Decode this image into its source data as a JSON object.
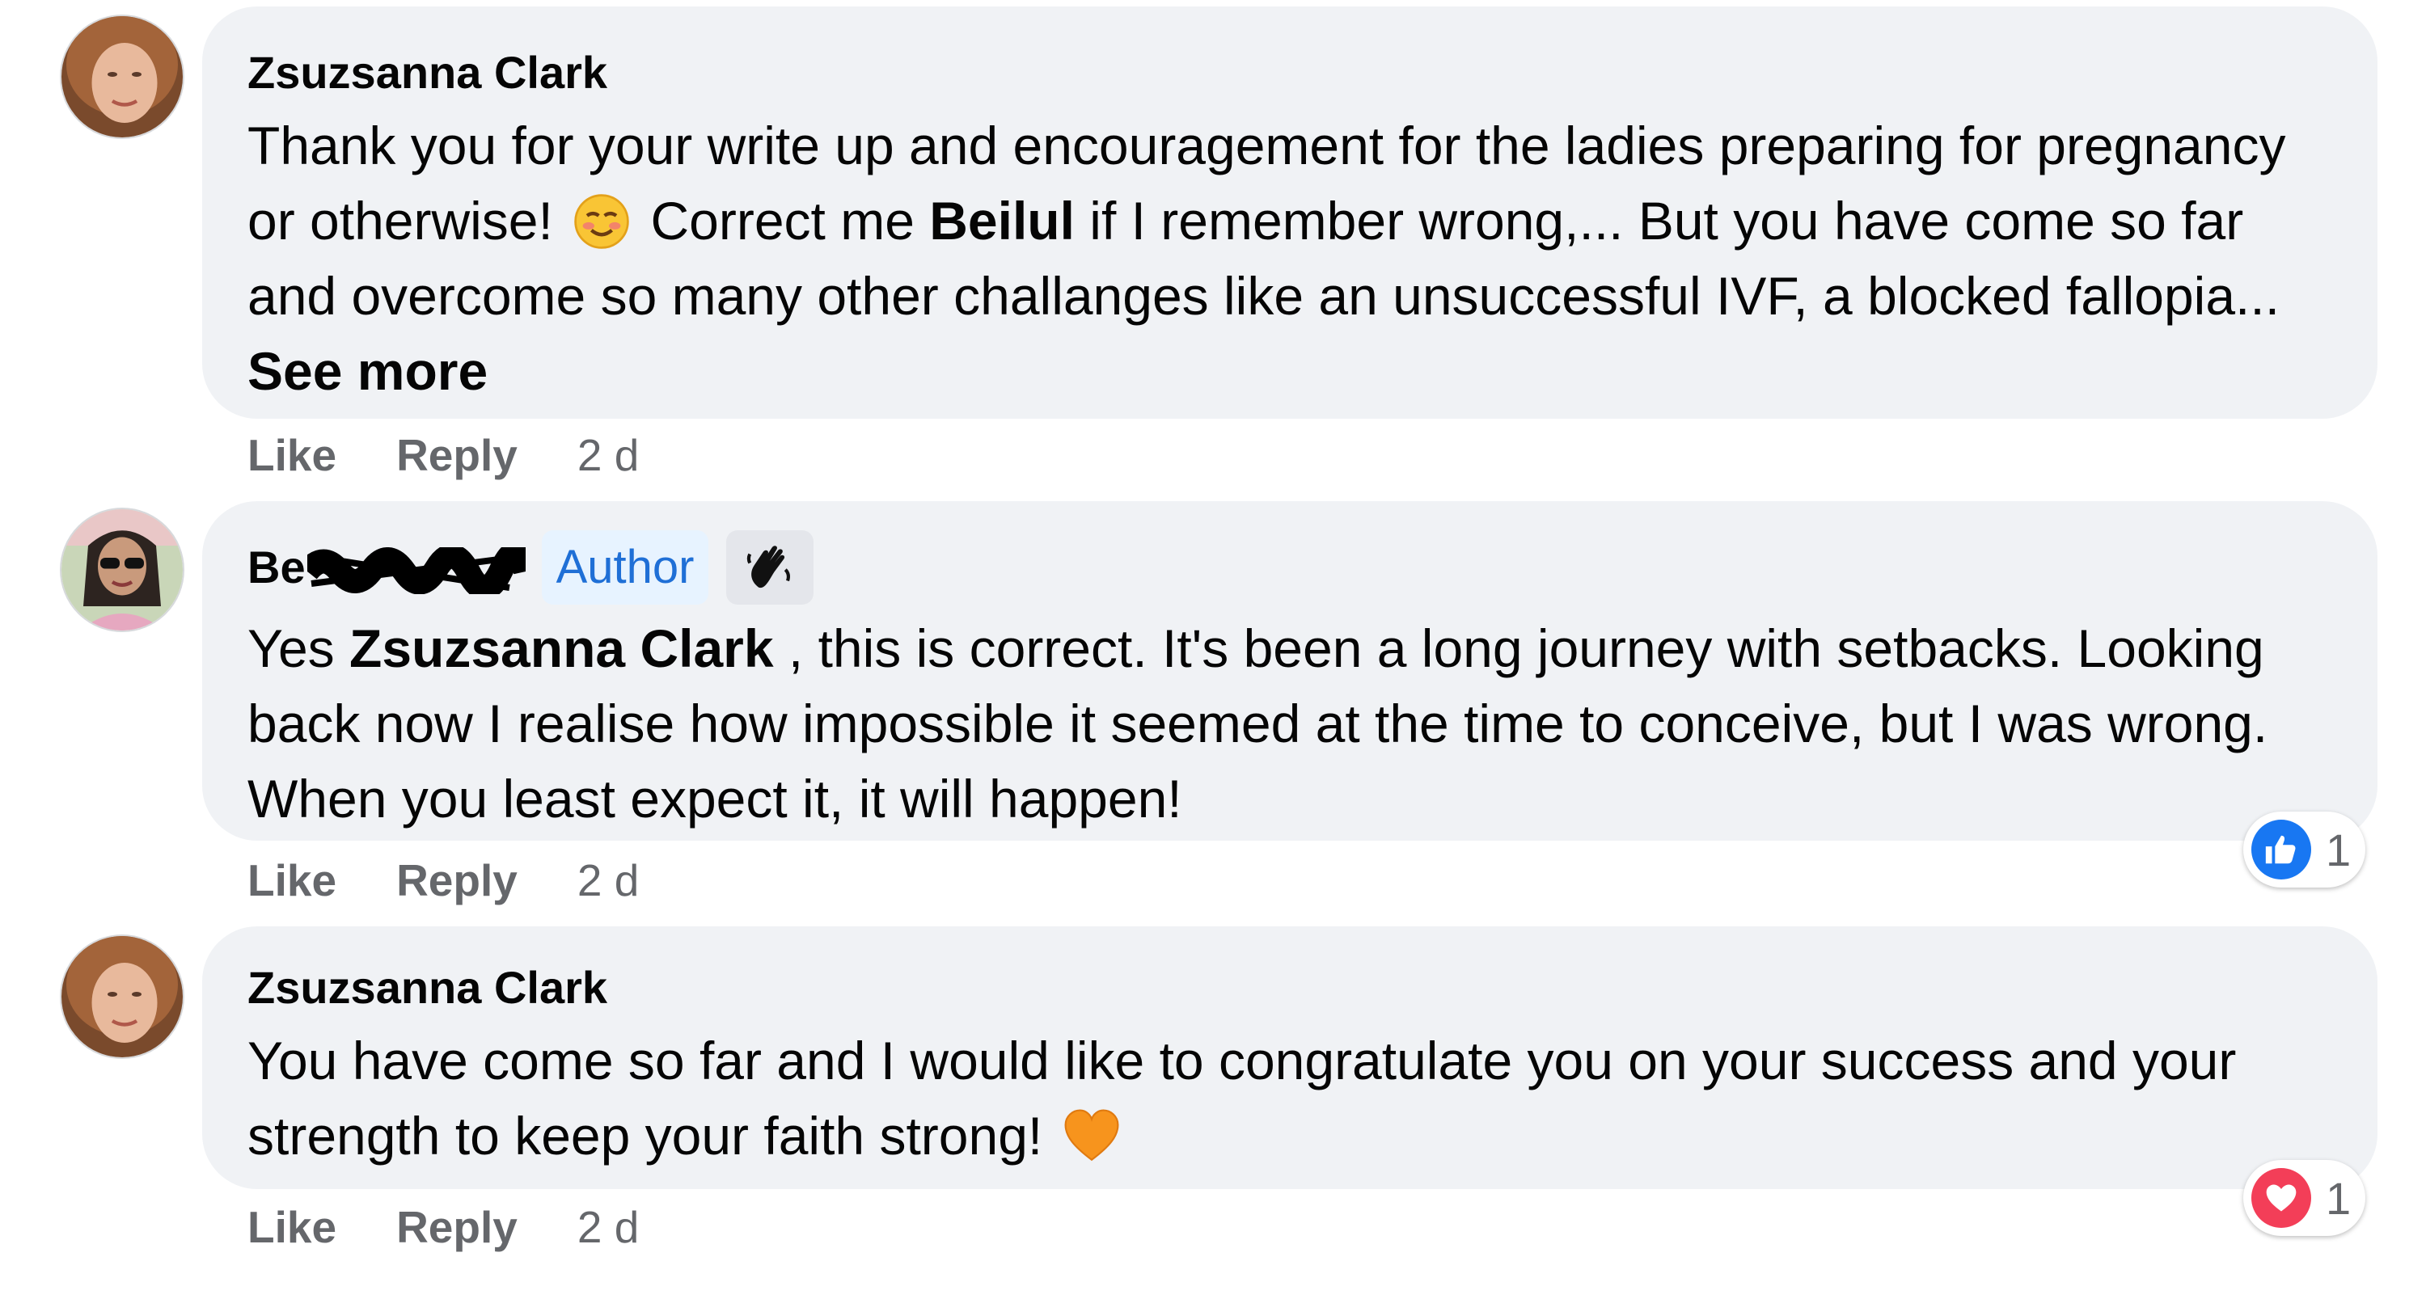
{
  "comments": [
    {
      "author": "Zsuzsanna Clark",
      "text_part1": "Thank you for your write up and encouragement for the ladies preparing for pregnancy or otherwise!",
      "text_part2": "Correct me",
      "mention": "Beilul",
      "text_part3": "if I remember wrong,... But you have come so far and overcome so many other challanges like an unsuccessful IVF, a blocked fallopia...",
      "see_more": "See more",
      "like_label": "Like",
      "reply_label": "Reply",
      "time": "2 d"
    },
    {
      "author_visible": "Be",
      "author_badge": "Author",
      "text_part1": "Yes",
      "mention": "Zsuzsanna Clark",
      "text_part2": ", this is correct. It's been a long journey with setbacks. Looking back now I realise how impossible it seemed at the time to conceive, but I was wrong. When you least expect it, it will happen!",
      "like_label": "Like",
      "reply_label": "Reply",
      "time": "2 d",
      "reaction": {
        "type": "like",
        "count": "1"
      }
    },
    {
      "author": "Zsuzsanna Clark",
      "text": "You have come so far and I would like to congratulate you on your success and your strength to keep your faith strong!",
      "like_label": "Like",
      "reply_label": "Reply",
      "time": "2 d",
      "reaction": {
        "type": "love",
        "count": "1"
      }
    }
  ],
  "colors": {
    "bubble": "#f0f2f5",
    "meta_text": "#65676b",
    "author_badge_bg": "#e7f3ff",
    "author_badge_text": "#1f6fd6",
    "like_blue": "#1877f2",
    "love_red": "#f33e58"
  }
}
